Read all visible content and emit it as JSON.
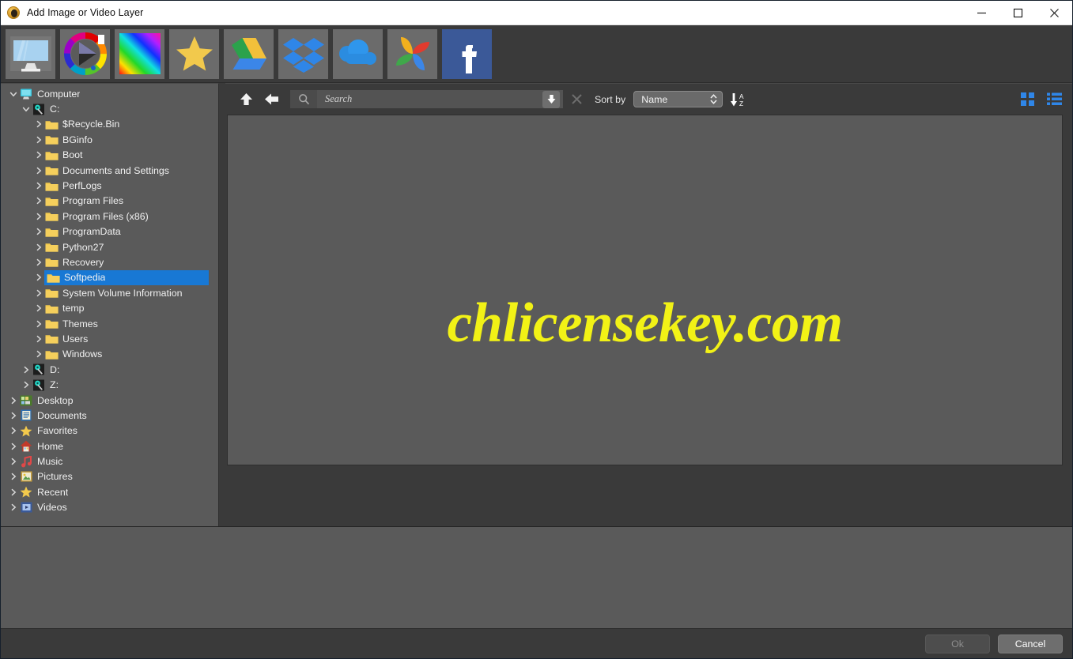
{
  "window": {
    "title": "Add Image or Video Layer",
    "app_icon": "app-logo-icon",
    "controls": {
      "minimize": "minimize-icon",
      "maximize": "maximize-icon",
      "close": "close-icon"
    }
  },
  "source_toolbar": {
    "items": [
      {
        "name": "computer",
        "icon": "computer-monitor-icon"
      },
      {
        "name": "color-picker",
        "icon": "color-wheel-icon"
      },
      {
        "name": "gradient",
        "icon": "gradient-icon"
      },
      {
        "name": "favorites",
        "icon": "star-icon"
      },
      {
        "name": "google-drive",
        "icon": "google-drive-icon"
      },
      {
        "name": "dropbox",
        "icon": "dropbox-icon"
      },
      {
        "name": "onedrive",
        "icon": "onedrive-cloud-icon"
      },
      {
        "name": "google-photos",
        "icon": "google-photos-icon"
      },
      {
        "name": "facebook",
        "icon": "facebook-icon"
      }
    ]
  },
  "sidebar": {
    "tree": [
      {
        "label": "Computer",
        "depth": 0,
        "icon": "computer-icon",
        "expanded": true,
        "selected": false
      },
      {
        "label": "C:",
        "depth": 1,
        "icon": "drive-icon",
        "expanded": true,
        "selected": false
      },
      {
        "label": "$Recycle.Bin",
        "depth": 2,
        "icon": "folder-icon",
        "expanded": false,
        "selected": false
      },
      {
        "label": "BGinfo",
        "depth": 2,
        "icon": "folder-icon",
        "expanded": false,
        "selected": false
      },
      {
        "label": "Boot",
        "depth": 2,
        "icon": "folder-icon",
        "expanded": false,
        "selected": false
      },
      {
        "label": "Documents and Settings",
        "depth": 2,
        "icon": "folder-icon",
        "expanded": false,
        "selected": false
      },
      {
        "label": "PerfLogs",
        "depth": 2,
        "icon": "folder-icon",
        "expanded": false,
        "selected": false
      },
      {
        "label": "Program Files",
        "depth": 2,
        "icon": "folder-icon",
        "expanded": false,
        "selected": false
      },
      {
        "label": "Program Files (x86)",
        "depth": 2,
        "icon": "folder-icon",
        "expanded": false,
        "selected": false
      },
      {
        "label": "ProgramData",
        "depth": 2,
        "icon": "folder-icon",
        "expanded": false,
        "selected": false
      },
      {
        "label": "Python27",
        "depth": 2,
        "icon": "folder-icon",
        "expanded": false,
        "selected": false
      },
      {
        "label": "Recovery",
        "depth": 2,
        "icon": "folder-icon",
        "expanded": false,
        "selected": false
      },
      {
        "label": "Softpedia",
        "depth": 2,
        "icon": "folder-icon",
        "expanded": false,
        "selected": true
      },
      {
        "label": "System Volume Information",
        "depth": 2,
        "icon": "folder-icon",
        "expanded": false,
        "selected": false
      },
      {
        "label": "temp",
        "depth": 2,
        "icon": "folder-icon",
        "expanded": false,
        "selected": false
      },
      {
        "label": "Themes",
        "depth": 2,
        "icon": "folder-icon",
        "expanded": false,
        "selected": false
      },
      {
        "label": "Users",
        "depth": 2,
        "icon": "folder-icon",
        "expanded": false,
        "selected": false
      },
      {
        "label": "Windows",
        "depth": 2,
        "icon": "folder-icon",
        "expanded": false,
        "selected": false
      },
      {
        "label": "D:",
        "depth": 1,
        "icon": "drive-icon",
        "expanded": false,
        "selected": false
      },
      {
        "label": "Z:",
        "depth": 1,
        "icon": "drive-icon",
        "expanded": false,
        "selected": false
      },
      {
        "label": "Desktop",
        "depth": 0,
        "icon": "desktop-icon",
        "expanded": false,
        "selected": false
      },
      {
        "label": "Documents",
        "depth": 0,
        "icon": "documents-icon",
        "expanded": false,
        "selected": false
      },
      {
        "label": "Favorites",
        "depth": 0,
        "icon": "star-icon",
        "expanded": false,
        "selected": false
      },
      {
        "label": "Home",
        "depth": 0,
        "icon": "home-icon",
        "expanded": false,
        "selected": false
      },
      {
        "label": "Music",
        "depth": 0,
        "icon": "music-icon",
        "expanded": false,
        "selected": false
      },
      {
        "label": "Pictures",
        "depth": 0,
        "icon": "pictures-icon",
        "expanded": false,
        "selected": false
      },
      {
        "label": "Recent",
        "depth": 0,
        "icon": "star-icon",
        "expanded": false,
        "selected": false
      },
      {
        "label": "Videos",
        "depth": 0,
        "icon": "video-icon",
        "expanded": false,
        "selected": false
      }
    ]
  },
  "filebar": {
    "up_icon": "arrow-up-icon",
    "back_icon": "arrow-left-icon",
    "search": {
      "value": "",
      "placeholder": "Search",
      "icon": "search-icon"
    },
    "download_icon": "download-arrow-icon",
    "clear_icon": "clear-x-icon",
    "sort_by_label": "Sort by",
    "sort_by_value": "Name",
    "sort_by_options": [
      "Name"
    ],
    "sort_direction_icon": "sort-az-descending-icon",
    "grid_view_icon": "grid-view-icon",
    "list_view_icon": "list-view-icon"
  },
  "fileview": {
    "watermark": "chlicensekey.com",
    "watermark_color": "#f2f216",
    "files": []
  },
  "footer": {
    "ok_label": "Ok",
    "ok_enabled": false,
    "cancel_label": "Cancel",
    "cancel_enabled": true
  },
  "colors": {
    "selection_blue": "#1878d4",
    "panel_gray": "#5a5a5a",
    "chrome_gray": "#3a3a3a",
    "folder_yellow": "#f5c542"
  }
}
